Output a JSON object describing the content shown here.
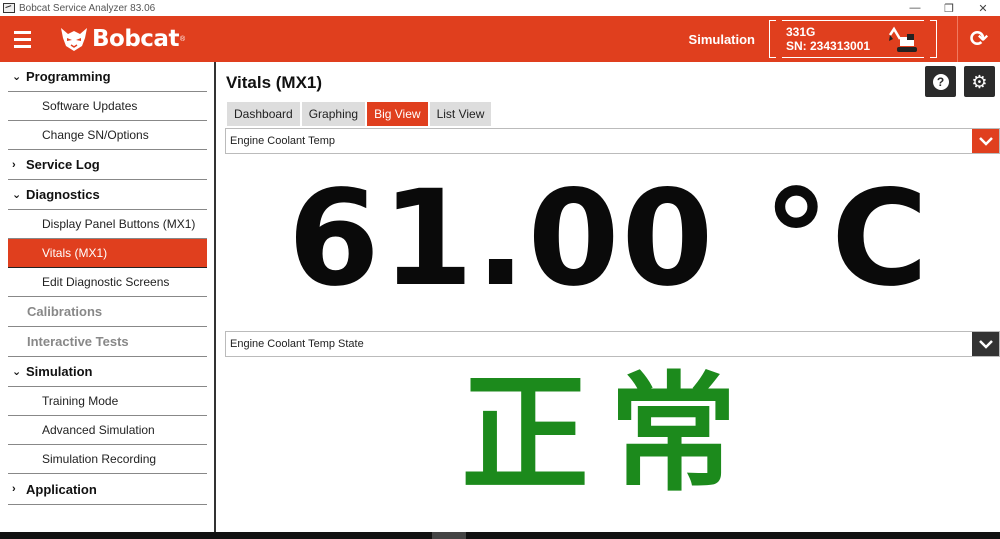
{
  "window": {
    "title": "Bobcat Service Analyzer 83.06",
    "controls": [
      "—",
      "❐",
      "✕"
    ]
  },
  "header": {
    "brand": "Bobcat",
    "mode": "Simulation",
    "model": "331G",
    "serial": "SN: 234313001",
    "brand_color": "#e03f1e"
  },
  "sidebar": {
    "programming": "Programming",
    "software_updates": "Software Updates",
    "change_sn": "Change SN/Options",
    "service_log": "Service Log",
    "diagnostics": "Diagnostics",
    "display_panel": "Display Panel Buttons (MX1)",
    "vitals": "Vitals (MX1)",
    "edit_diag": "Edit Diagnostic Screens",
    "calibrations": "Calibrations",
    "interactive_tests": "Interactive Tests",
    "simulation": "Simulation",
    "training_mode": "Training Mode",
    "advanced_sim": "Advanced Simulation",
    "sim_recording": "Simulation Recording",
    "application": "Application"
  },
  "main": {
    "title": "Vitals (MX1)",
    "tabs": [
      "Dashboard",
      "Graphing",
      "Big View",
      "List View"
    ],
    "active_tab": "Big View",
    "select1": "Engine Coolant Temp",
    "value": "61.00 °C",
    "select2": "Engine Coolant Temp State",
    "state": "正常",
    "state_color": "#1c8a1c"
  }
}
